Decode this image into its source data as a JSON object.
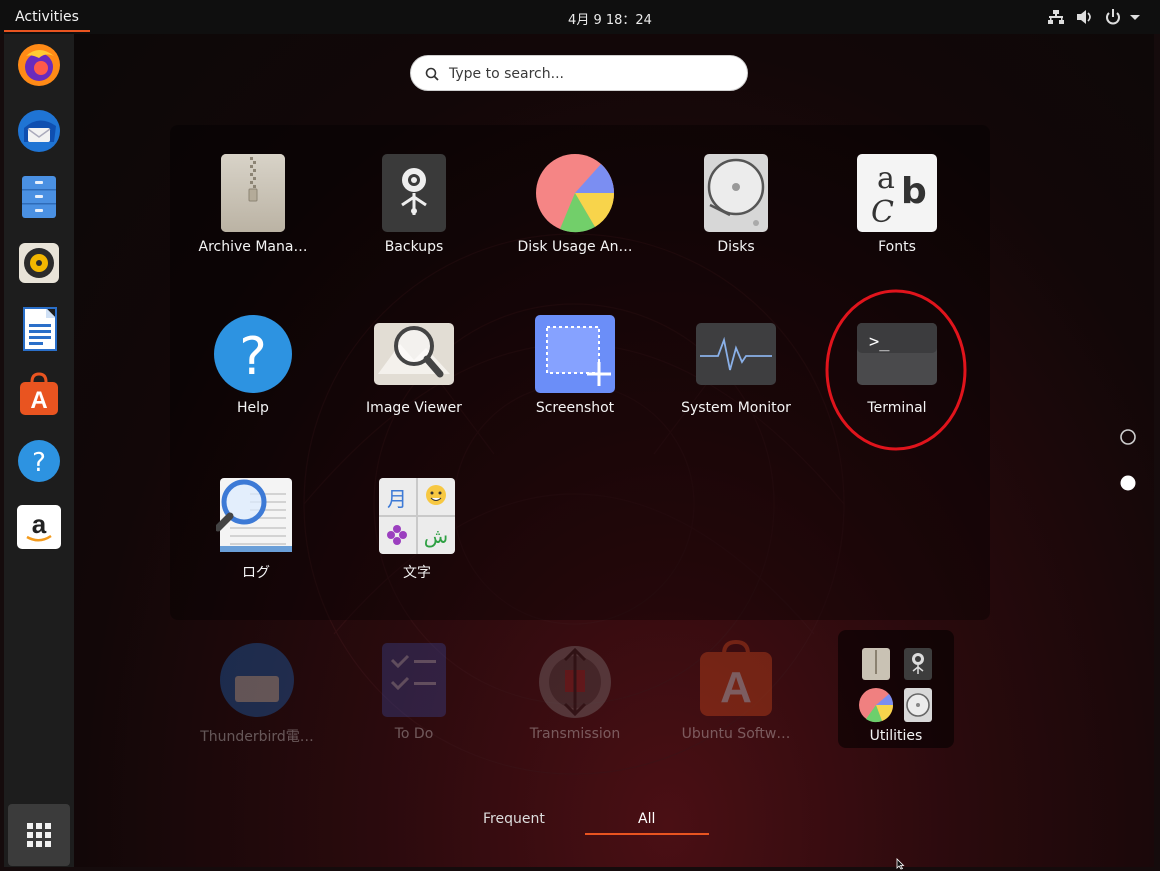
{
  "topbar": {
    "activities_label": "Activities",
    "clock": "4月 9  18：24",
    "tray_icons": [
      "network-icon",
      "volume-icon",
      "power-icon",
      "dropdown-icon"
    ]
  },
  "dock": {
    "items": [
      {
        "name": "firefox-icon"
      },
      {
        "name": "thunderbird-icon"
      },
      {
        "name": "files-icon"
      },
      {
        "name": "rhythmbox-icon"
      },
      {
        "name": "libreoffice-writer-icon"
      },
      {
        "name": "ubuntu-software-icon"
      },
      {
        "name": "help-icon"
      },
      {
        "name": "amazon-icon"
      }
    ],
    "show_apps_icon": "app-grid-icon"
  },
  "search": {
    "placeholder": "Type to search..."
  },
  "apps": [
    {
      "label": "Archive Mana…",
      "icon": "archive-manager-icon"
    },
    {
      "label": "Backups",
      "icon": "backups-icon"
    },
    {
      "label": "Disk Usage An…",
      "icon": "disk-usage-icon"
    },
    {
      "label": "Disks",
      "icon": "disks-icon"
    },
    {
      "label": "Fonts",
      "icon": "fonts-icon"
    },
    {
      "label": "Help",
      "icon": "help-icon"
    },
    {
      "label": "Image Viewer",
      "icon": "image-viewer-icon"
    },
    {
      "label": "Screenshot",
      "icon": "screenshot-icon"
    },
    {
      "label": "System Monitor",
      "icon": "system-monitor-icon"
    },
    {
      "label": "Terminal",
      "icon": "terminal-icon"
    },
    {
      "label": "ログ",
      "icon": "logs-icon"
    },
    {
      "label": "文字",
      "icon": "characters-icon"
    }
  ],
  "background_apps": [
    {
      "label": "Thunderbird電…",
      "icon": "thunderbird-icon"
    },
    {
      "label": "To Do",
      "icon": "todo-icon"
    },
    {
      "label": "Transmission",
      "icon": "transmission-icon"
    },
    {
      "label": "Ubuntu Softw…",
      "icon": "ubuntu-software-icon"
    }
  ],
  "folder": {
    "label": "Utilities"
  },
  "tabs": [
    {
      "label": "Frequent"
    },
    {
      "label": "All"
    }
  ],
  "icon_glyphs": {
    "fonts_a": "a",
    "fonts_b": "b",
    "fonts_c": "C",
    "help": "?",
    "terminal_prompt": ">_",
    "characters_tl": "月",
    "characters_br": "ش",
    "amazon": "a",
    "ubuntu_a": "A"
  },
  "colors": {
    "accent": "#e95420",
    "highlight_circle": "#e0141c"
  }
}
